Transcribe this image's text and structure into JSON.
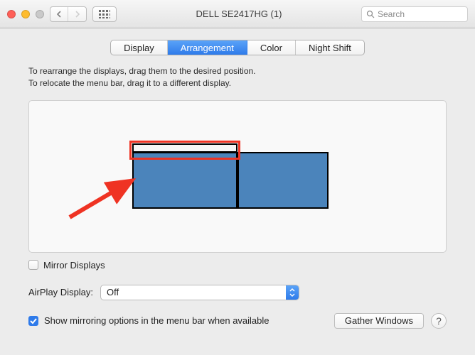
{
  "window": {
    "title": "DELL SE2417HG (1)",
    "search_placeholder": "Search"
  },
  "tabs": {
    "display": "Display",
    "arrangement": "Arrangement",
    "color": "Color",
    "night_shift": "Night Shift"
  },
  "instructions": {
    "line1": "To rearrange the displays, drag them to the desired position.",
    "line2": "To relocate the menu bar, drag it to a different display."
  },
  "mirror": {
    "label": "Mirror Displays",
    "checked": false
  },
  "airplay": {
    "label": "AirPlay Display:",
    "value": "Off"
  },
  "show_mirror": {
    "label": "Show mirroring options in the menu bar when available",
    "checked": true
  },
  "gather_button": "Gather Windows",
  "help_char": "?"
}
